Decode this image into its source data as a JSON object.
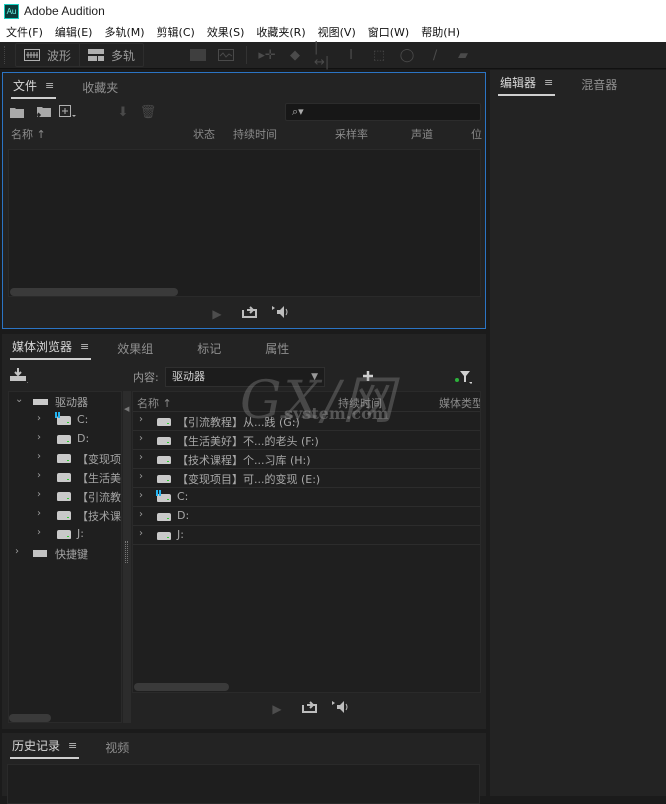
{
  "app": {
    "logo": "Au",
    "title": "Adobe Audition"
  },
  "menu": [
    "文件(F)",
    "编辑(E)",
    "多轨(M)",
    "剪辑(C)",
    "效果(S)",
    "收藏夹(R)",
    "视图(V)",
    "窗口(W)",
    "帮助(H)"
  ],
  "toolbar": {
    "modes": [
      {
        "label": "波形",
        "icon": "waveform-icon"
      },
      {
        "label": "多轨",
        "icon": "multitrack-icon"
      }
    ],
    "tools": [
      "spectral-frequency-icon",
      "spectral-pitch-icon",
      "move-tool-icon",
      "razor-tool-icon",
      "slip-tool-icon",
      "time-selection-icon",
      "marquee-icon",
      "lasso-icon",
      "brush-icon",
      "spot-healing-icon"
    ]
  },
  "files_panel": {
    "tabs": [
      {
        "label": "文件",
        "active": true
      },
      {
        "label": "收藏夹",
        "active": false
      }
    ],
    "menu_glyph": "≡",
    "search_glyph": "⌕▾",
    "columns": [
      "名称 ↑",
      "状态",
      "持续时间",
      "采样率",
      "声道",
      "位"
    ],
    "transport": {
      "play": "▶",
      "loop": "⮌",
      "autoplay": "◀)"
    }
  },
  "media_panel": {
    "tabs": [
      {
        "label": "媒体浏览器",
        "active": true
      },
      {
        "label": "效果组",
        "active": false
      },
      {
        "label": "标记",
        "active": false
      },
      {
        "label": "属性",
        "active": false
      }
    ],
    "content_label": "内容:",
    "content_value": "驱动器",
    "tree": {
      "root": "驱动器",
      "items": [
        "C:",
        "D:",
        "【变现项",
        "【生活美",
        "【引流教",
        "【技术课",
        "J:"
      ],
      "shortcuts": "快捷键"
    },
    "columns": [
      "名称 ↑",
      "持续时间",
      "媒体类型"
    ],
    "rows": [
      {
        "label": "【引流教程】从...践 (G:)",
        "windows": false
      },
      {
        "label": "【生活美好】不...的老头 (F:)",
        "windows": false
      },
      {
        "label": "【技术课程】个...习库 (H:)",
        "windows": false
      },
      {
        "label": "【变现项目】可...的变现 (E:)",
        "windows": false
      },
      {
        "label": "C:",
        "windows": true
      },
      {
        "label": "D:",
        "windows": false
      },
      {
        "label": "J:",
        "windows": false
      }
    ]
  },
  "history_panel": {
    "tabs": [
      {
        "label": "历史记录",
        "active": true
      },
      {
        "label": "视频",
        "active": false
      }
    ]
  },
  "editor_panel": {
    "tabs": [
      {
        "label": "编辑器",
        "active": true
      },
      {
        "label": "混音器",
        "active": false
      }
    ]
  },
  "watermark": {
    "big": "GX/网",
    "small": "system.com"
  },
  "colors": {
    "focus_border": "#2b74c4",
    "panel_bg": "#232323",
    "accent_win": "#23b3f0"
  }
}
